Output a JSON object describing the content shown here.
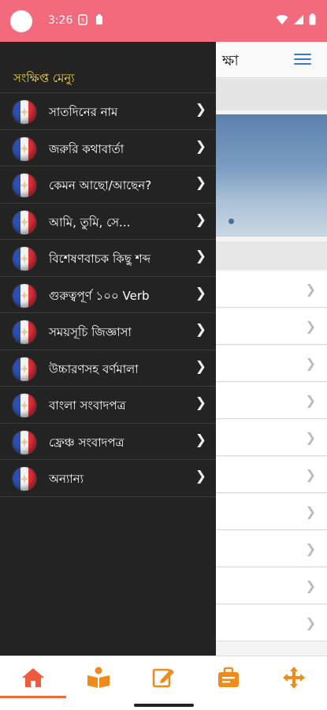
{
  "status_bar": {
    "time": "3:26",
    "icons": [
      "sim-icon",
      "battery-saver-icon",
      "wifi-icon",
      "signal-icon",
      "battery-icon"
    ]
  },
  "background_page": {
    "title_fragment": "ক্ষা",
    "menu_icon": "list-menu-icon"
  },
  "drawer": {
    "header": "সংক্ষিপ্ত মেন্যু",
    "items": [
      {
        "label": "সাতদিনের নাম"
      },
      {
        "label": "জরুরি কথাবার্তা"
      },
      {
        "label": "কেমন আছো/আছেন?"
      },
      {
        "label": "আমি, তুমি, সে..."
      },
      {
        "label": "বিশেষণবাচক কিছু শব্দ"
      },
      {
        "label": "গুরুত্বপূর্ণ ১০০ Verb"
      },
      {
        "label": "সময়সূচি জিজ্ঞাসা"
      },
      {
        "label": "উচ্চারণসহ বর্ণমালা"
      },
      {
        "label": "বাংলা সংবাদপত্র"
      },
      {
        "label": "ফ্রেঞ্চ সংবাদপত্র"
      },
      {
        "label": "অন্যান্য"
      }
    ],
    "item_icon": "french-flag-icon",
    "chevron_icon": "chevron-right-icon"
  },
  "bottom_nav": {
    "items": [
      "home-icon",
      "book-reader-icon",
      "edit-icon",
      "briefcase-icon",
      "move-arrows-icon"
    ],
    "active_index": 0
  },
  "colors": {
    "status_bar": "#f36a7c",
    "drawer_bg": "#232323",
    "drawer_header": "#f5d44b",
    "accent": "#f36a3a",
    "menu_icon": "#3a78c9"
  }
}
